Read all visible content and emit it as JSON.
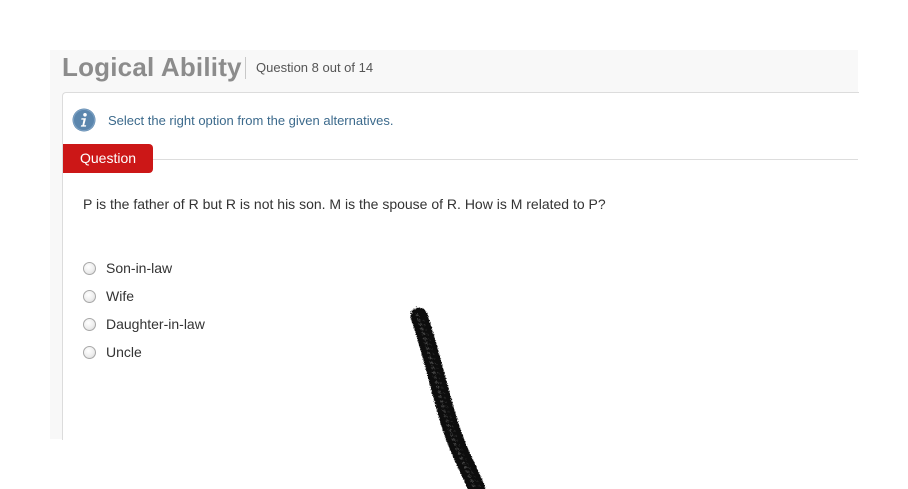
{
  "header": {
    "title": "Logical Ability",
    "progress": "Question 8 out of 14"
  },
  "instruction": {
    "icon": "info-icon",
    "text": "Select the right option from the given alternatives."
  },
  "question_tab": {
    "label": "Question",
    "color": "#cc1717"
  },
  "question": {
    "text": "P is the father of R but R is not his son. M is the spouse of R. How is M related to P?",
    "options": [
      {
        "label": "Son-in-law",
        "selected": false
      },
      {
        "label": "Wife",
        "selected": false
      },
      {
        "label": "Daughter-in-law",
        "selected": false
      },
      {
        "label": "Uncle",
        "selected": false
      }
    ]
  },
  "colors": {
    "accent": "#cc1717",
    "info": "#5b86ad",
    "info_text": "#3c6a8c"
  }
}
